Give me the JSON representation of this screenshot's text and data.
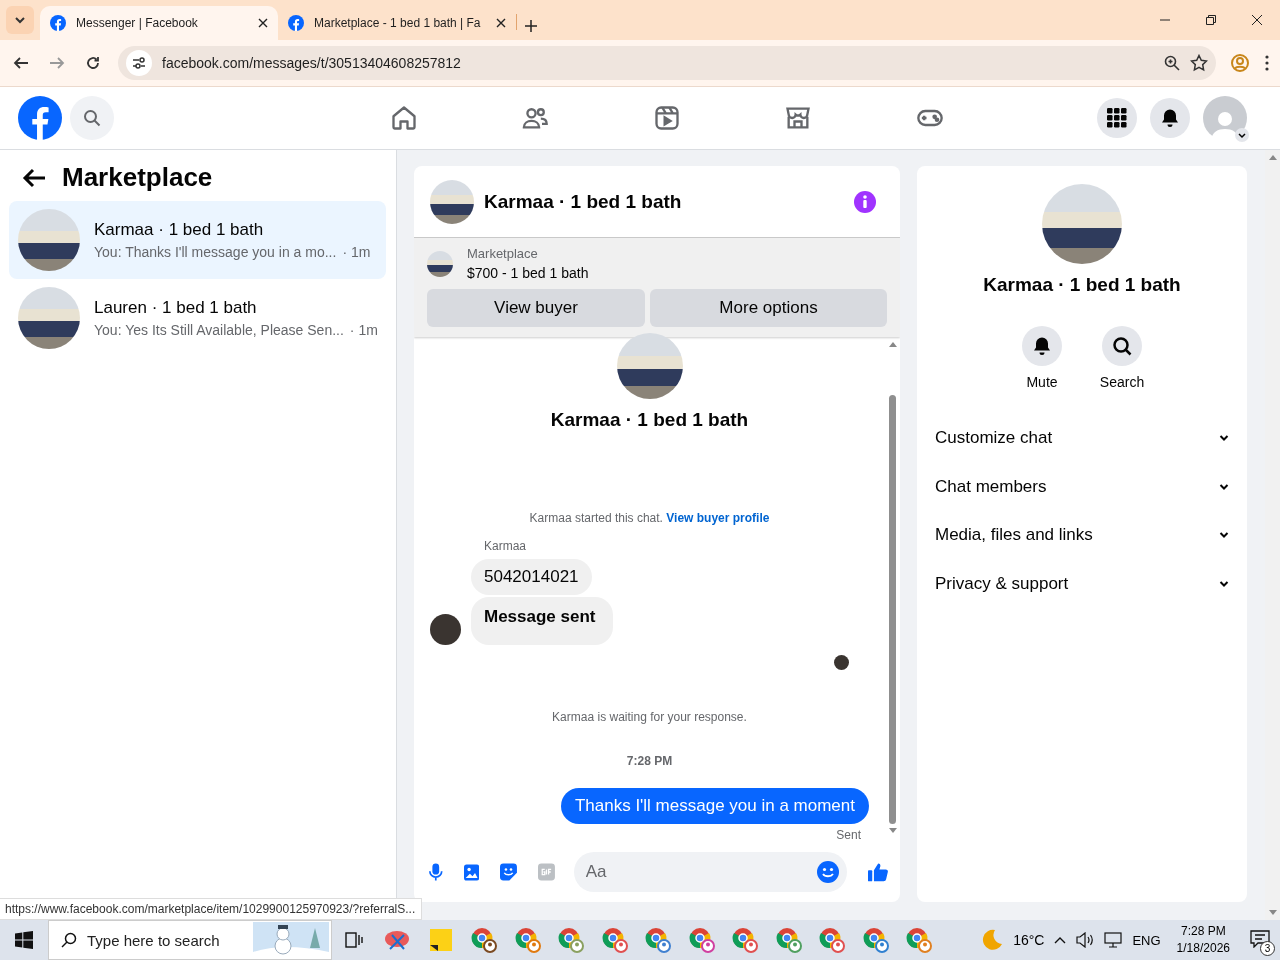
{
  "browser": {
    "tabs": [
      {
        "title": "Messenger | Facebook",
        "selected": true
      },
      {
        "title": "Marketplace - 1 bed 1 bath | Fa",
        "selected": false
      }
    ],
    "url": "facebook.com/messages/t/30513404608257812"
  },
  "sidebar": {
    "title": "Marketplace",
    "conversations": [
      {
        "name": "Karmaa · 1 bed 1 bath",
        "preview": "You: Thanks I'll message you in a mo...",
        "time": "· 1m",
        "selected": true
      },
      {
        "name": "Lauren · 1 bed 1 bath",
        "preview": "You: Yes Its Still Available, Please Sen...",
        "time": "· 1m",
        "selected": false
      }
    ]
  },
  "chat": {
    "title": "Karmaa · 1 bed 1 bath",
    "listing": {
      "label": "Marketplace",
      "title": "$700 - 1 bed 1 bath"
    },
    "buttons": [
      "View buyer",
      "More options"
    ],
    "profile_name": "Karmaa · 1 bed 1 bath",
    "messages": [
      {
        "kind": "system",
        "text": "Karmaa started this chat.",
        "link": "View buyer profile"
      },
      {
        "kind": "sender",
        "text": "Karmaa"
      },
      {
        "kind": "incoming",
        "text": "5042014021"
      },
      {
        "kind": "incoming-large",
        "text": "Message sent"
      },
      {
        "kind": "read-receipt"
      },
      {
        "kind": "system",
        "text": "Karmaa is waiting for your response."
      },
      {
        "kind": "timestamp",
        "text": "7:28 PM"
      },
      {
        "kind": "outgoing",
        "text": "Thanks I'll message you in a moment"
      },
      {
        "kind": "status",
        "text": "Sent"
      }
    ],
    "composer": {
      "placeholder": "Aa"
    }
  },
  "details": {
    "name": "Karmaa · 1 bed 1 bath",
    "actions": [
      {
        "kind": "mute",
        "label": "Mute"
      },
      {
        "kind": "search",
        "label": "Search"
      }
    ],
    "sections": [
      "Customize chat",
      "Chat members",
      "Media, files and links",
      "Privacy & support"
    ]
  },
  "status_url": "https://www.facebook.com/marketplace/item/1029900125970923/?referralS...",
  "taskbar": {
    "search_placeholder": "Type here to search",
    "temperature": "16°C",
    "language": "ENG",
    "time": "7:28 PM",
    "date": "1/18/2026",
    "notifications": "3"
  }
}
